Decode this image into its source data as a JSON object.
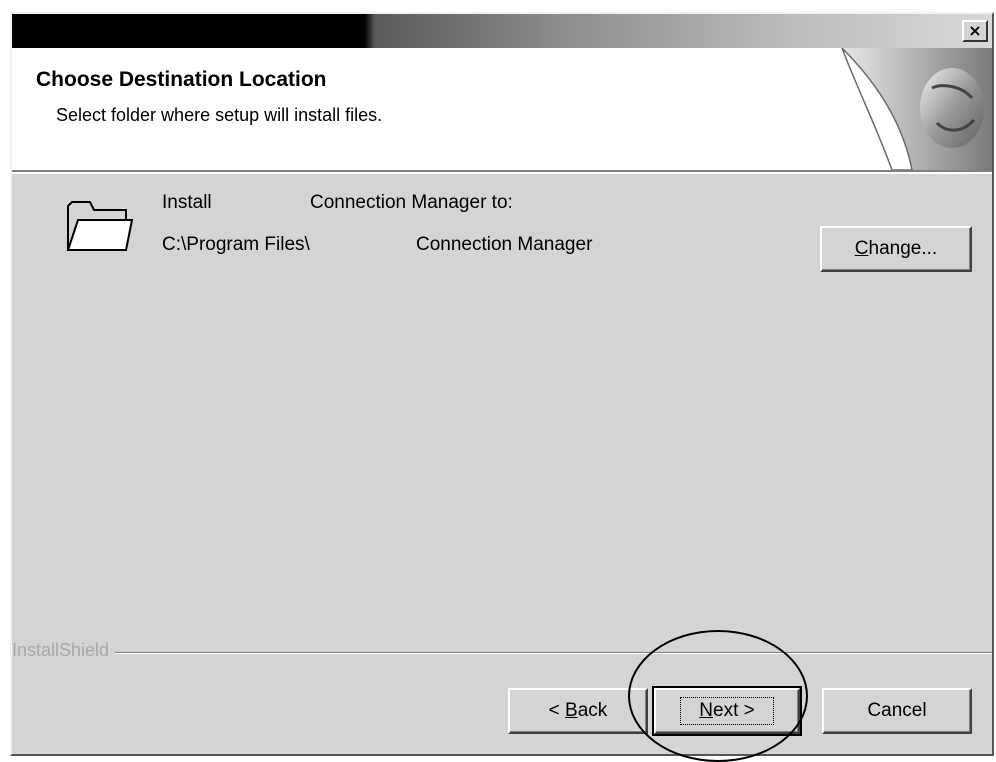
{
  "header": {
    "title": "Choose Destination Location",
    "subtitle": "Select folder where setup will install files."
  },
  "titlebar": {
    "close_glyph": "×"
  },
  "content": {
    "install_label": "Install",
    "product_name_line1": "Connection Manager to:",
    "path_part1": "C:\\Program Files\\",
    "path_part2": "Connection Manager",
    "folder_icon": "folder-icon"
  },
  "footer": {
    "brand": "InstallShield"
  },
  "buttons": {
    "change": {
      "accel": "C",
      "rest": "hange..."
    },
    "back": {
      "prefix": "< ",
      "accel": "B",
      "rest": "ack"
    },
    "next": {
      "accel": "N",
      "rest": "ext >"
    },
    "cancel": "Cancel"
  },
  "colors": {
    "face": "#d4d4d4",
    "header_bg": "#ffffff",
    "titlebar_dark": "#000000"
  }
}
